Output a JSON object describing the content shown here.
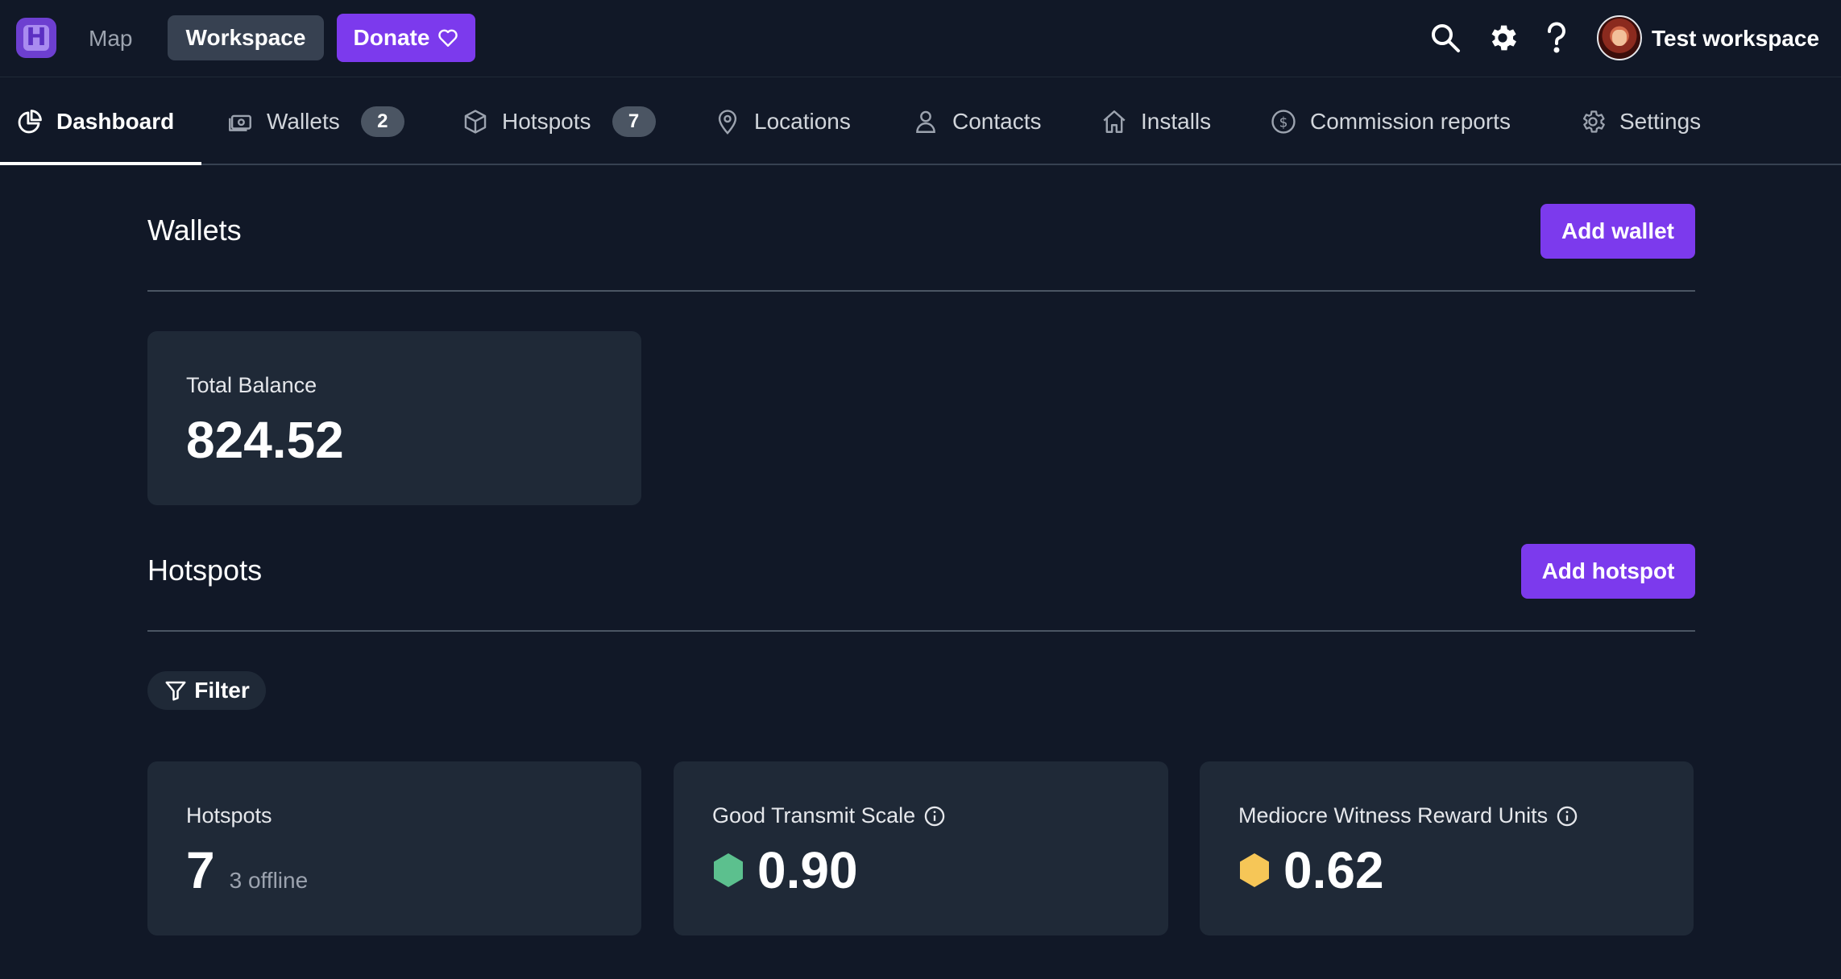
{
  "topbar": {
    "logo_letter": "H",
    "map_label": "Map",
    "workspace_label": "Workspace",
    "donate_label": "Donate",
    "workspace_name": "Test workspace"
  },
  "tabs": [
    {
      "label": "Dashboard",
      "icon": "pie-chart-icon",
      "active": true
    },
    {
      "label": "Wallets",
      "icon": "wallet-icon",
      "badge": "2"
    },
    {
      "label": "Hotspots",
      "icon": "cube-icon",
      "badge": "7"
    },
    {
      "label": "Locations",
      "icon": "map-pin-icon"
    },
    {
      "label": "Contacts",
      "icon": "user-icon"
    },
    {
      "label": "Installs",
      "icon": "home-icon"
    },
    {
      "label": "Commission reports",
      "icon": "dollar-circle-icon"
    },
    {
      "label": "Settings",
      "icon": "gear-icon"
    }
  ],
  "wallets": {
    "title": "Wallets",
    "add_label": "Add wallet",
    "total_label": "Total Balance",
    "total_value": "824.52"
  },
  "hotspots": {
    "title": "Hotspots",
    "add_label": "Add hotspot",
    "filter_label": "Filter",
    "cards": {
      "count": {
        "label": "Hotspots",
        "value": "7",
        "sub": "3 offline"
      },
      "transmit": {
        "label": "Good Transmit Scale",
        "value": "0.90",
        "hex_color": "#5cc08e"
      },
      "witness": {
        "label": "Mediocre Witness Reward Units",
        "value": "0.62",
        "hex_color": "#f6c657"
      }
    }
  },
  "colors": {
    "background": "#111827",
    "card": "#1f2937",
    "accent": "#7c3aed"
  }
}
